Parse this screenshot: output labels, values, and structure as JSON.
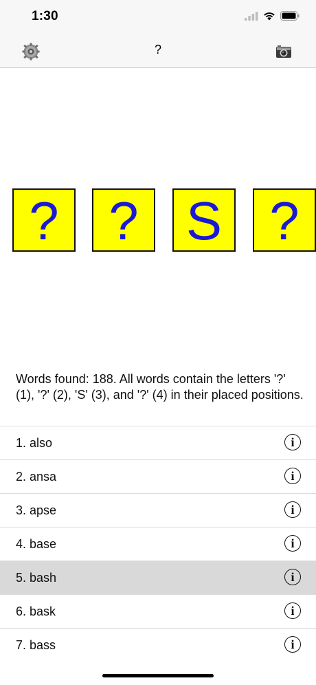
{
  "status_bar": {
    "time": "1:30"
  },
  "nav": {
    "title": "?",
    "left_icon": "gear-icon",
    "right_icon": "camera-icon"
  },
  "tiles": [
    "?",
    "?",
    "S",
    "?"
  ],
  "colors": {
    "tile_bg": "#ffff00",
    "tile_text": "#1a1ad6",
    "selected_row": "#d9d9d9"
  },
  "description": "Words found: 188.  All words contain the letters '?' (1), '?' (2), 'S' (3), and '?' (4) in their placed positions.",
  "words": [
    {
      "label": "1. also"
    },
    {
      "label": "2. ansa"
    },
    {
      "label": "3. apse"
    },
    {
      "label": "4. base"
    },
    {
      "label": "5. bash",
      "selected": true
    },
    {
      "label": "6. bask"
    },
    {
      "label": "7. bass"
    }
  ],
  "info_glyph": "i"
}
